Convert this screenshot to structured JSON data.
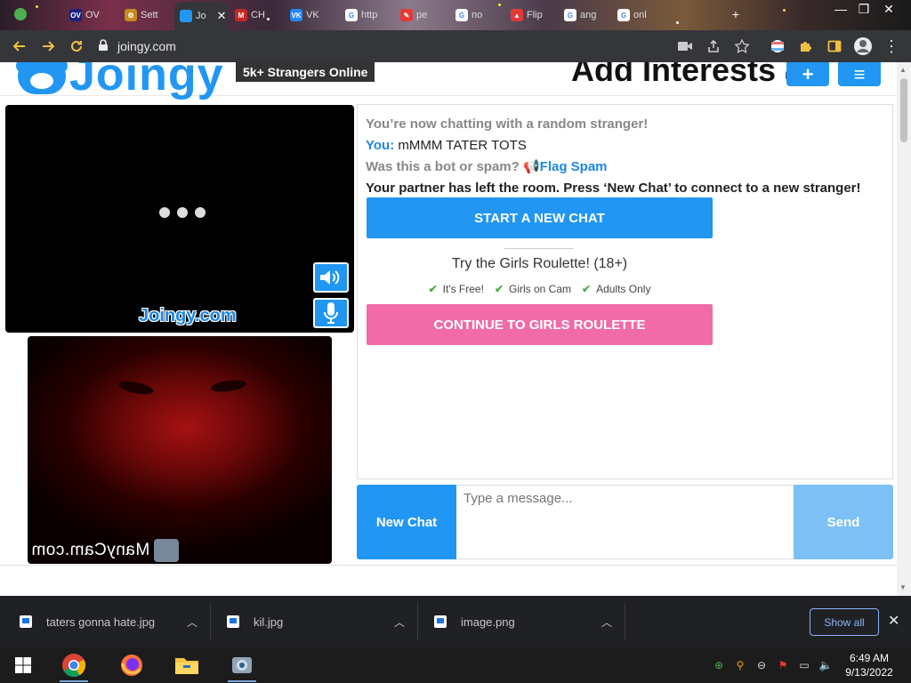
{
  "browser": {
    "tabs": [
      {
        "label": "OV",
        "fav": "OV",
        "color": "#1a237e"
      },
      {
        "label": "Sett",
        "fav": "⚙",
        "color": "#c58a1b"
      },
      {
        "label": "Jo",
        "fav": "",
        "color": "#2196f3",
        "active": true
      },
      {
        "label": "CH",
        "fav": "M",
        "color": "#c62828"
      },
      {
        "label": "VK",
        "fav": "VK",
        "color": "#2787f5"
      },
      {
        "label": "http",
        "fav": "G",
        "color": "#ffffff"
      },
      {
        "label": "pe",
        "fav": "✎",
        "color": "#e53935"
      },
      {
        "label": "no",
        "fav": "G",
        "color": "#ffffff"
      },
      {
        "label": "Flip",
        "fav": "▲",
        "color": "#e53935"
      },
      {
        "label": "ang",
        "fav": "G",
        "color": "#ffffff"
      },
      {
        "label": "onl",
        "fav": "G",
        "color": "#ffffff"
      }
    ],
    "close_glyph": "✕",
    "url": "joingy.com"
  },
  "header": {
    "logo_text": "Joingy",
    "online_badge": "5k+ Strangers Online",
    "interests_label": "Add Interests",
    "plus_label": "+",
    "menu_label": "≡"
  },
  "video": {
    "stranger_watermark": "Joingy.com",
    "self_watermark": "ManyCam.com"
  },
  "chat": {
    "system_intro": "You’re now chatting with a random stranger!",
    "you_label": "You:",
    "you_message": "mMMM TATER TOTS",
    "spam_question": "Was this a bot or spam?",
    "flag_label": "Flag Spam",
    "partner_left": "Your partner has left the room. Press ‘New Chat’ to connect to a new stranger!",
    "start_button": "START A NEW CHAT",
    "roulette_title": "Try the Girls Roulette! (18+)",
    "roulette_features": [
      "It's Free!",
      "Girls on Cam",
      "Adults Only"
    ],
    "roulette_button": "CONTINUE TO GIRLS ROULETTE"
  },
  "input": {
    "new_chat": "New Chat",
    "placeholder": "Type a message...",
    "send": "Send"
  },
  "downloads": {
    "items": [
      {
        "name": "taters gonna hate.jpg"
      },
      {
        "name": "kil.jpg"
      },
      {
        "name": "image.png"
      }
    ],
    "show_all": "Show all",
    "close": "✕"
  },
  "taskbar": {
    "time": "6:49 AM",
    "date": "9/13/2022"
  }
}
